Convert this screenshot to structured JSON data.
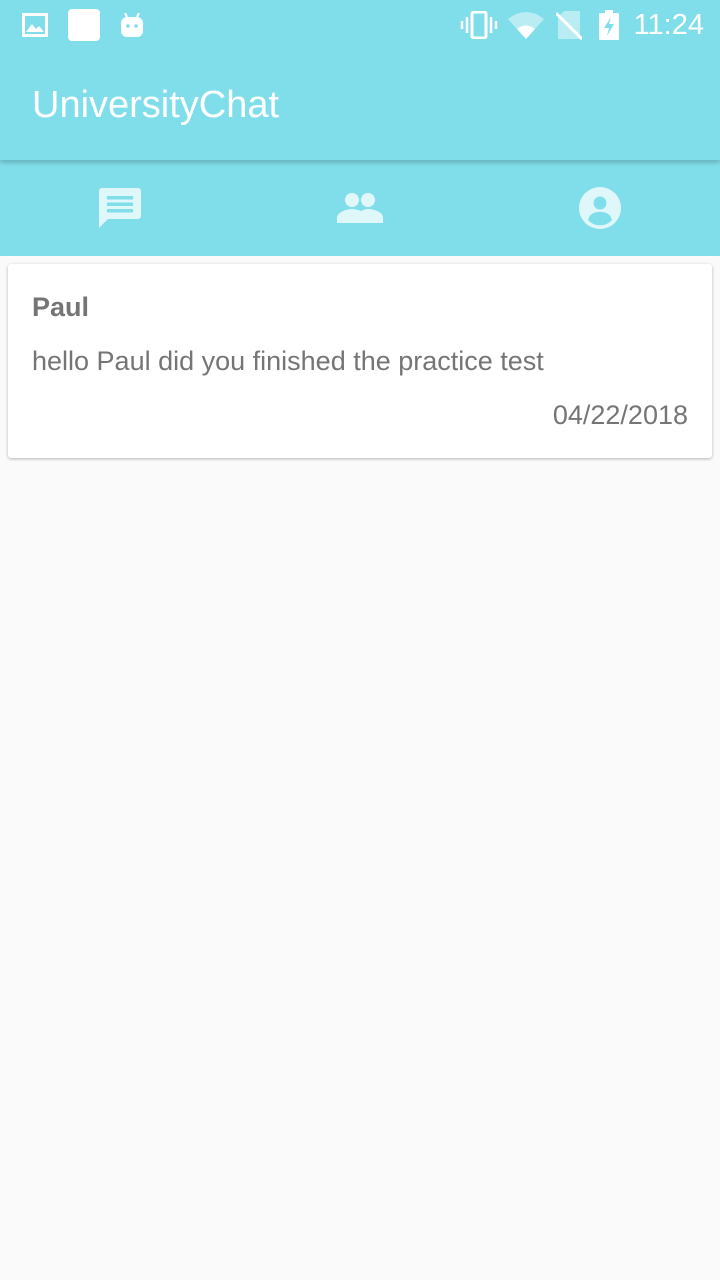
{
  "status_bar": {
    "time": "11:24",
    "icons": [
      "image-icon",
      "square-notification-icon",
      "android-icon",
      "vibrate-icon",
      "wifi-icon",
      "no-sim-icon",
      "battery-charging-icon"
    ]
  },
  "app_bar": {
    "title": "UniversityChat"
  },
  "tabs": [
    {
      "name": "chats",
      "icon": "chat-icon",
      "selected": true
    },
    {
      "name": "contacts",
      "icon": "people-icon",
      "selected": false
    },
    {
      "name": "profile",
      "icon": "account-circle-icon",
      "selected": false
    }
  ],
  "conversations": [
    {
      "name": "Paul",
      "message": "hello Paul did you finished the practice test",
      "date": "04/22/2018"
    }
  ],
  "colors": {
    "primary": "#80deea",
    "tab_selected": "#e0f7fa",
    "tab_unselected": "#e0f7fa",
    "text": "#757575",
    "background": "#fafafa"
  }
}
